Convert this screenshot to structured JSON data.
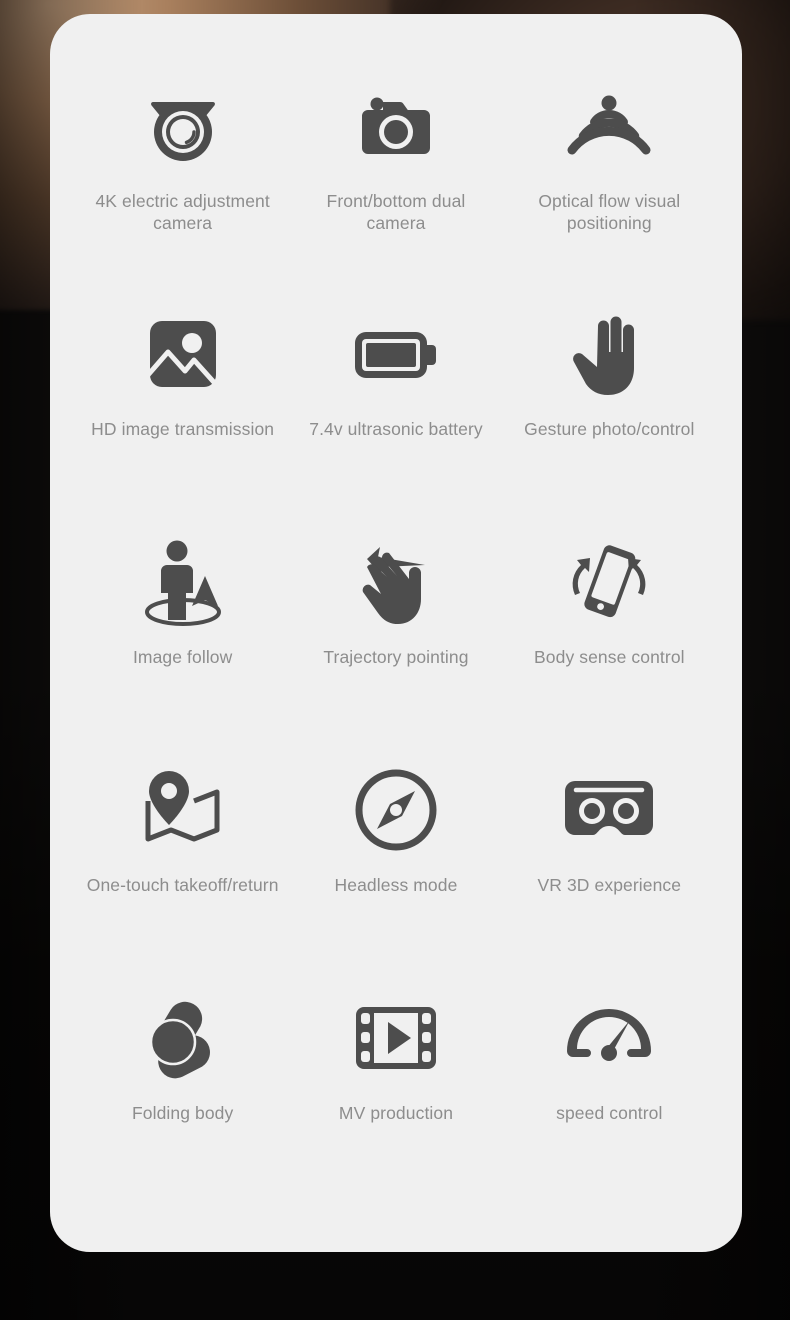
{
  "card": {
    "background_color": "#f0f0f0",
    "icon_color": "#4d4d4d",
    "label_color": "#8d8d8d"
  },
  "page": {
    "background_color": "#0b0a09",
    "accent_warm": "#a87f5d"
  },
  "features": [
    {
      "icon": "dome-camera-icon",
      "label": "4K electric adjustment camera"
    },
    {
      "icon": "photo-camera-icon",
      "label": "Front/bottom dual camera"
    },
    {
      "icon": "signal-waves-icon",
      "label": "Optical flow visual positioning"
    },
    {
      "icon": "image-picture-icon",
      "label": "HD image transmission"
    },
    {
      "icon": "battery-icon",
      "label": "7.4v ultrasonic battery"
    },
    {
      "icon": "hand-palm-icon",
      "label": "Gesture photo/control"
    },
    {
      "icon": "person-follow-icon",
      "label": "Image follow"
    },
    {
      "icon": "hand-swipe-icon",
      "label": "Trajectory pointing"
    },
    {
      "icon": "phone-tilt-icon",
      "label": "Body sense control"
    },
    {
      "icon": "map-pin-icon",
      "label": "One-touch takeoff/return"
    },
    {
      "icon": "compass-icon",
      "label": "Headless mode"
    },
    {
      "icon": "vr-goggles-icon",
      "label": "VR 3D experience"
    },
    {
      "icon": "folding-arms-icon",
      "label": "Folding body"
    },
    {
      "icon": "film-play-icon",
      "label": "MV production"
    },
    {
      "icon": "speedometer-icon",
      "label": "speed control"
    }
  ]
}
